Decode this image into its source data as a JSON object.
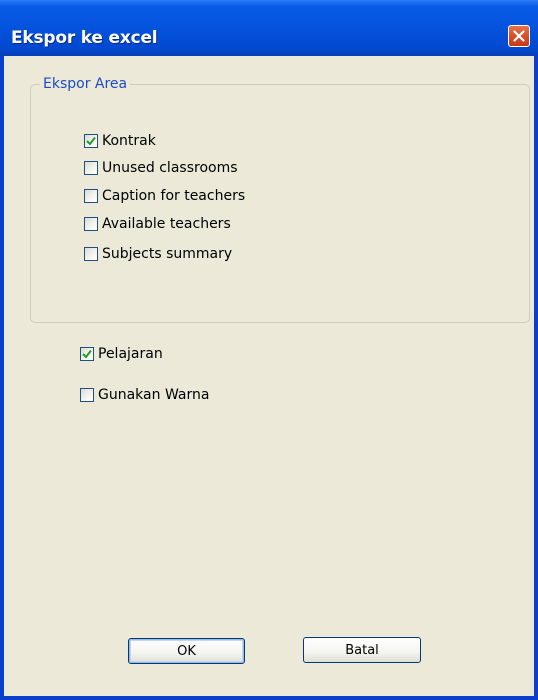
{
  "dialog": {
    "title": "Ekspor ke excel",
    "close_icon": "close-icon"
  },
  "export_area": {
    "label": "Ekspor Area",
    "items": [
      {
        "label": "Kontrak",
        "checked": true
      },
      {
        "label": "Unused classrooms",
        "checked": false
      },
      {
        "label": "Caption for teachers",
        "checked": false
      },
      {
        "label": "Available teachers",
        "checked": false
      },
      {
        "label": "Subjects summary",
        "checked": false
      }
    ]
  },
  "options": [
    {
      "label": "Pelajaran",
      "checked": true
    },
    {
      "label": "Gunakan Warna",
      "checked": false
    }
  ],
  "buttons": {
    "ok": "OK",
    "cancel": "Batal"
  },
  "colors": {
    "titlebar": "#0453DD",
    "dialog_bg": "#ECE9D8",
    "group_label": "#1B4CC4",
    "checkmark": "#21A121",
    "close_button": "#D9532C"
  }
}
